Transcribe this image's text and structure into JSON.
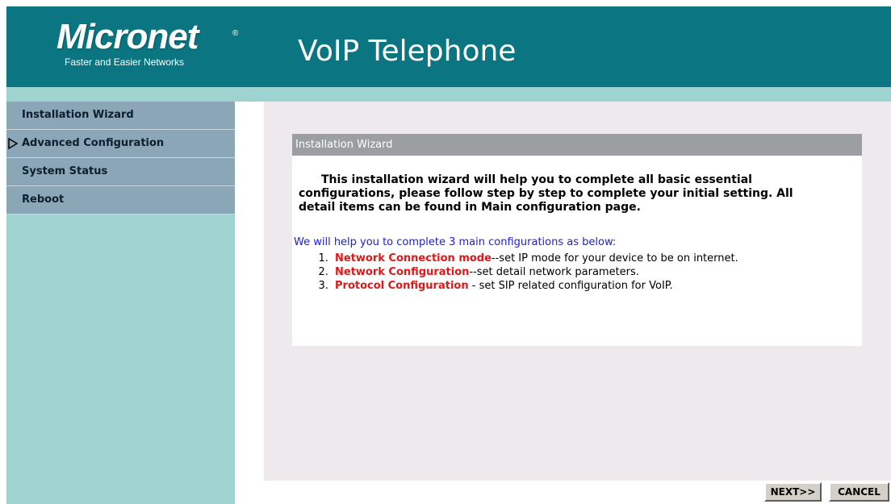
{
  "header": {
    "logo_name": "Micronet",
    "logo_tagline": "Faster and Easier Networks",
    "logo_registered": "®",
    "title": "VoIP Telephone",
    "color": "#0b7682"
  },
  "sidebar": {
    "items": [
      {
        "label": "Installation Wizard",
        "selected": false
      },
      {
        "label": "Advanced Configuration",
        "selected": true,
        "marker_icon": "triangle-right-icon"
      },
      {
        "label": "System Status",
        "selected": false
      },
      {
        "label": "Reboot",
        "selected": false
      }
    ]
  },
  "panel": {
    "heading": "Installation Wizard",
    "intro": "This installation wizard will help you to complete all basic essential configurations, please follow step by step to complete your initial setting. All detail items can be found in Main configuration page.",
    "subheading": "We will help you to complete 3 main configurations as below:",
    "steps": [
      {
        "name": "Network Connection mode",
        "desc": "--set IP mode for your device to be on internet."
      },
      {
        "name": "Network Configuration",
        "desc": "--set detail network parameters."
      },
      {
        "name": "Protocol Configuration",
        "desc": " - set SIP related configuration for VoIP."
      }
    ]
  },
  "buttons": {
    "next": "NEXT>>",
    "cancel": "CANCEL"
  },
  "colors": {
    "sidebar_bg": "#9fd3cf",
    "menu_item_bg": "#8ba6b7",
    "step_name": "#e01818",
    "subheading": "#2020d8"
  }
}
